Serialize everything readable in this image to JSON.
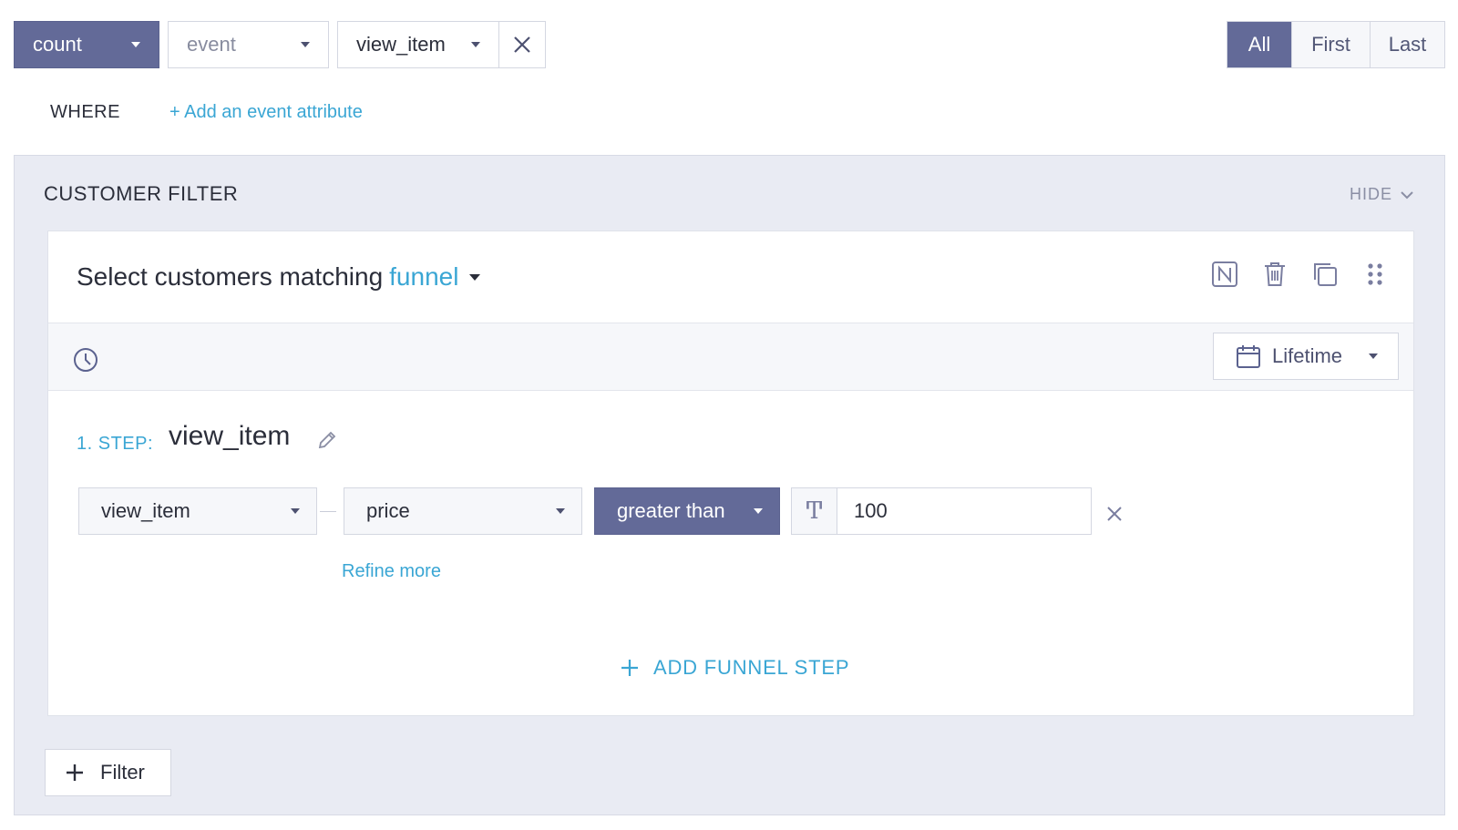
{
  "query": {
    "aggregation": "count",
    "source_placeholder": "event",
    "event_name": "view_item"
  },
  "occurrence_toggle": {
    "options": [
      "All",
      "First",
      "Last"
    ],
    "selected": "All"
  },
  "where": {
    "label": "WHERE",
    "add_attribute_link": "+ Add an event attribute"
  },
  "customer_filter": {
    "title": "CUSTOMER FILTER",
    "hide_label": "HIDE",
    "card": {
      "title_prefix": "Select customers matching",
      "match_type": "funnel",
      "actions": [
        "negate-icon",
        "trash-icon",
        "duplicate-icon",
        "drag-handle-icon"
      ],
      "time_range": "Lifetime",
      "step": {
        "label": "1. STEP:",
        "name": "view_item",
        "condition": {
          "event": "view_item",
          "attribute": "price",
          "operator": "greater than",
          "value_type_icon": "text-type-icon",
          "value": "100"
        },
        "refine_link": "Refine more"
      },
      "add_step_label": "ADD FUNNEL STEP"
    },
    "add_filter_label": "Filter"
  },
  "colors": {
    "accent": "#3aa6d4",
    "primary_dark": "#636a98",
    "panel_bg": "#e9ebf3"
  }
}
